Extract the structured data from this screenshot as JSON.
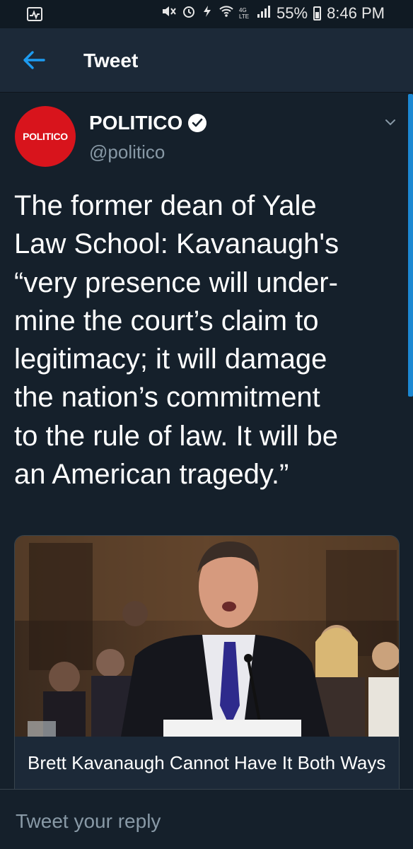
{
  "status_bar": {
    "battery": "55%",
    "time": "8:46 PM",
    "network": "4G LTE"
  },
  "app_bar": {
    "title": "Tweet",
    "back_icon": "arrow-left-icon"
  },
  "tweet": {
    "author_name": "POLITICO",
    "author_handle": "@politico",
    "avatar_text": "POLITICO",
    "text": "The former dean of Yale\nLaw School: Kavanaugh's\n“very presence will under-\nmine the court’s claim to\nlegitimacy; it will damage\nthe nation’s commitment\nto the rule of law. It will be\nan American tragedy.”",
    "card": {
      "title": "Brett Kavanaugh Cannot Have It Both Ways"
    }
  },
  "reply": {
    "placeholder": "Tweet your reply"
  },
  "colors": {
    "background": "#15202b",
    "accent": "#1d9bf0",
    "avatar_red": "#d8141c",
    "secondary_text": "#8899a6"
  }
}
